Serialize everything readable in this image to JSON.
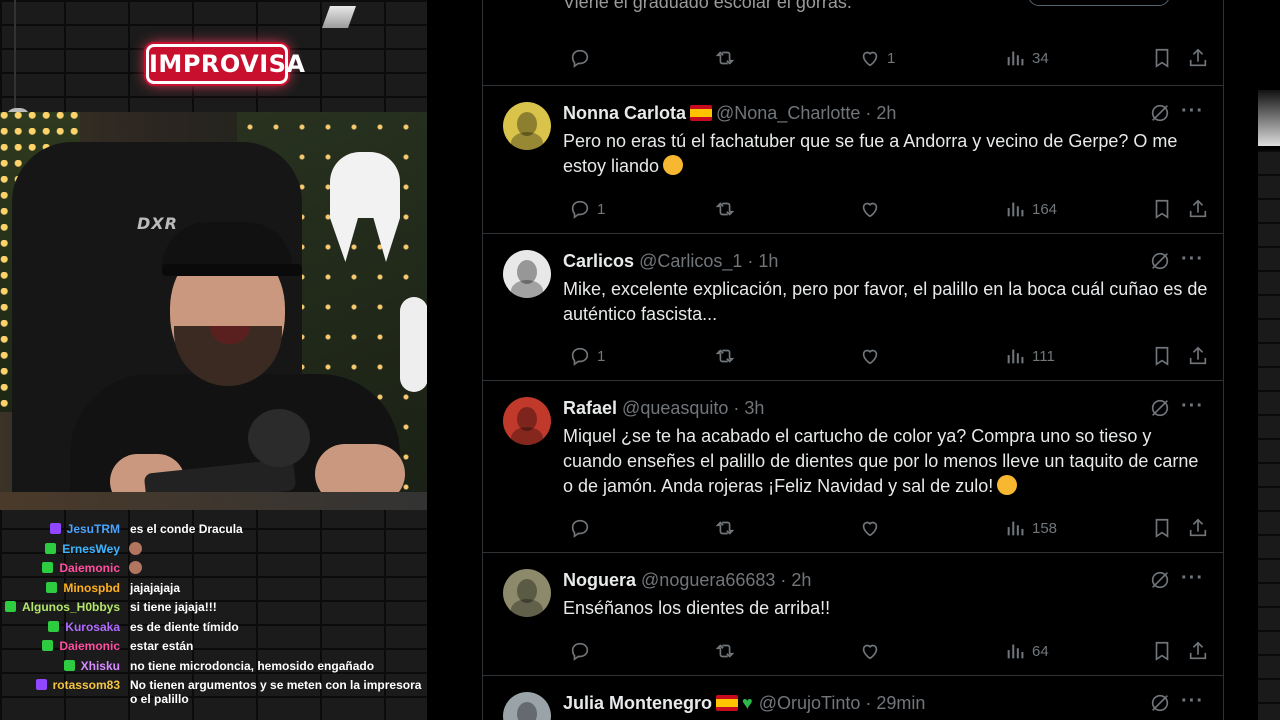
{
  "stream": {
    "logo_text": "IMPROVISA",
    "chair_brand": "DXR"
  },
  "chat": [
    {
      "badge_color": "#9146ff",
      "name": "JesuTRM",
      "name_color": "#4ba3ff",
      "text": "es el conde Dracula",
      "emote": false
    },
    {
      "badge_color": "#2ecc40",
      "name": "ErnesWey",
      "name_color": "#3fb4ff",
      "text": "",
      "emote": true
    },
    {
      "badge_color": "#2ecc40",
      "name": "Daiemonic",
      "name_color": "#ff4fa0",
      "text": "",
      "emote": true
    },
    {
      "badge_color": "#2ecc40",
      "name": "Minospbd",
      "name_color": "#ffb020",
      "text": "jajajajaja",
      "emote": false
    },
    {
      "badge_color": "#2ecc40",
      "name": "Algunos_H0bbys",
      "name_color": "#b3e66b",
      "text": "si tiene jajaja!!!",
      "emote": false
    },
    {
      "badge_color": "#2ecc40",
      "name": "Kurosaka",
      "name_color": "#b06bff",
      "text": "es de diente tímido",
      "emote": false
    },
    {
      "badge_color": "#2ecc40",
      "name": "Daiemonic",
      "name_color": "#ff4fa0",
      "text": "estar están",
      "emote": false
    },
    {
      "badge_color": "#2ecc40",
      "name": "Xhisku",
      "name_color": "#d68cff",
      "text": "no tiene microdoncia, hemosido engañado",
      "emote": false
    },
    {
      "badge_color": "#9146ff",
      "name": "rotassom83",
      "name_color": "#f5c542",
      "text": "No tienen argumentos y se meten con la impresora o el palillo",
      "emote": false
    }
  ],
  "feed": {
    "partial_top": {
      "text": "Viene el graduado escolar el gorras.",
      "replies": "",
      "reposts": "",
      "likes": "1",
      "views": "34"
    },
    "tweets": [
      {
        "name": "Nonna Carlota",
        "flag": true,
        "handle": "@Nona_Charlotte",
        "time": "· 2h",
        "text": "Pero no eras tú el fachatuber que se fue a Andorra y vecino de Gerpe? O me estoy liando",
        "emoji": "thinking-emoji",
        "replies": "1",
        "likes": "",
        "views": "164",
        "avatar_color": "#d9c34a"
      },
      {
        "name": "Carlicos",
        "flag": false,
        "handle": "@Carlicos_1",
        "time": "· 1h",
        "text": "Mike, excelente explicación, pero por favor, el palillo en la boca cuál cuñao es de auténtico fascista...",
        "emoji": "",
        "replies": "1",
        "likes": "",
        "views": "111",
        "avatar_color": "#e8e8e8"
      },
      {
        "name": "Rafael",
        "flag": false,
        "handle": "@queasquito",
        "time": "· 3h",
        "text": "Miquel ¿se te ha acabado el cartucho de color ya? Compra uno so tieso y cuando enseñes el palillo de dientes que por lo menos lleve un taquito de carne o de jamón. Anda rojeras ¡Feliz Navidad y sal de zulo!",
        "emoji": "relieved-emoji",
        "replies": "",
        "likes": "",
        "views": "158",
        "avatar_color": "#c0392b"
      },
      {
        "name": "Noguera",
        "flag": false,
        "handle": "@noguera66683",
        "time": "· 2h",
        "text": "Enséñanos los dientes de arriba!!",
        "emoji": "",
        "replies": "",
        "likes": "",
        "views": "64",
        "avatar_color": "#8c8a6a"
      },
      {
        "name": "Julia Montenegro",
        "flag": true,
        "handle": "@OrujoTinto",
        "time": "· 29min",
        "text": "",
        "emoji": "green-heart",
        "replies": "",
        "likes": "",
        "views": "",
        "avatar_color": "#9aa3a8"
      }
    ]
  },
  "colors": {
    "background": "#000000",
    "divider": "#2f3336",
    "text_primary": "#e7e9ea",
    "text_secondary": "#71767b"
  }
}
